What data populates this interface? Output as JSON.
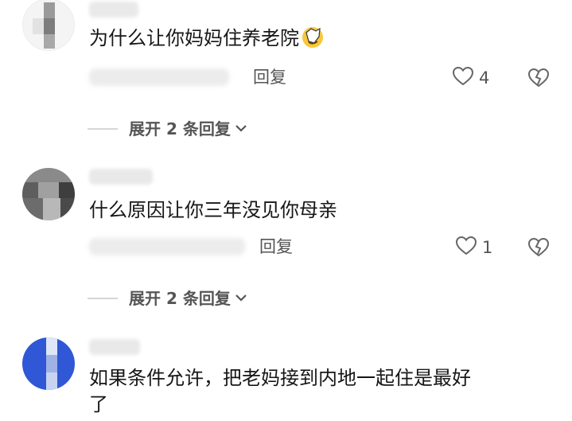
{
  "comments": [
    {
      "text": "为什么让你妈妈住养老院",
      "reply_label": "回复",
      "likes": "4",
      "emoji": "facepalm-emoji",
      "expand_label": "展开 2 条回复"
    },
    {
      "text": "什么原因让你三年没见你母亲",
      "reply_label": "回复",
      "likes": "1",
      "expand_label": "展开 2 条回复"
    },
    {
      "text_line1": "如果条件允许，把老妈接到内地一起住是最好",
      "text_line2": "了"
    }
  ],
  "colors": {
    "text": "#161616",
    "secondary": "#555555",
    "divider": "#d6d6d6",
    "avatar3_blue": "#2f57d6"
  }
}
